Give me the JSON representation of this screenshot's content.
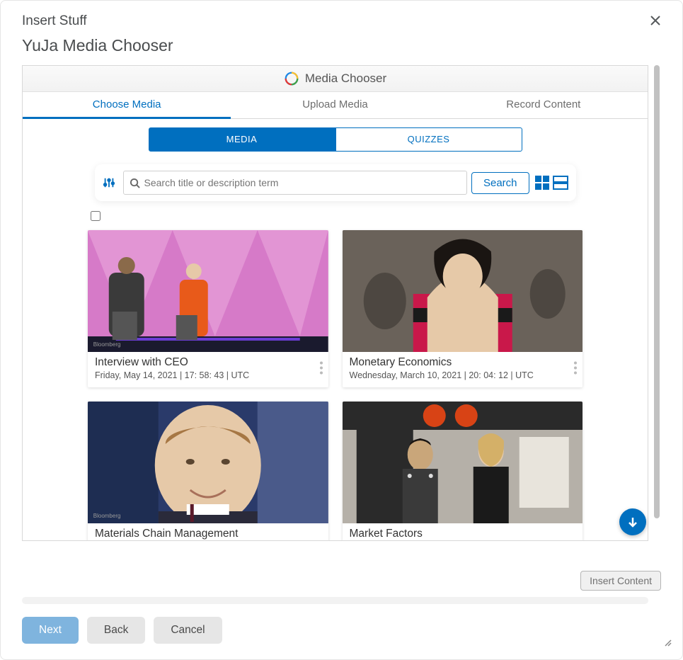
{
  "modal": {
    "title": "Insert Stuff",
    "subtitle": "YuJa Media Chooser"
  },
  "app": {
    "name": "Media Chooser"
  },
  "tabs_primary": {
    "choose": "Choose Media",
    "upload": "Upload Media",
    "record": "Record Content"
  },
  "tabs_secondary": {
    "media": "MEDIA",
    "quizzes": "QUIZZES"
  },
  "search": {
    "placeholder": "Search title or description term",
    "button": "Search"
  },
  "media_items": [
    {
      "title": "Interview with CEO",
      "meta": "Friday, May 14, 2021 | 17: 58: 43 | UTC"
    },
    {
      "title": "Monetary Economics",
      "meta": "Wednesday, March 10, 2021 | 20: 04: 12 | UTC"
    },
    {
      "title": "Materials Chain Management",
      "meta": ""
    },
    {
      "title": "Market Factors",
      "meta": ""
    }
  ],
  "actions": {
    "insert_content": "Insert Content",
    "next": "Next",
    "back": "Back",
    "cancel": "Cancel"
  }
}
